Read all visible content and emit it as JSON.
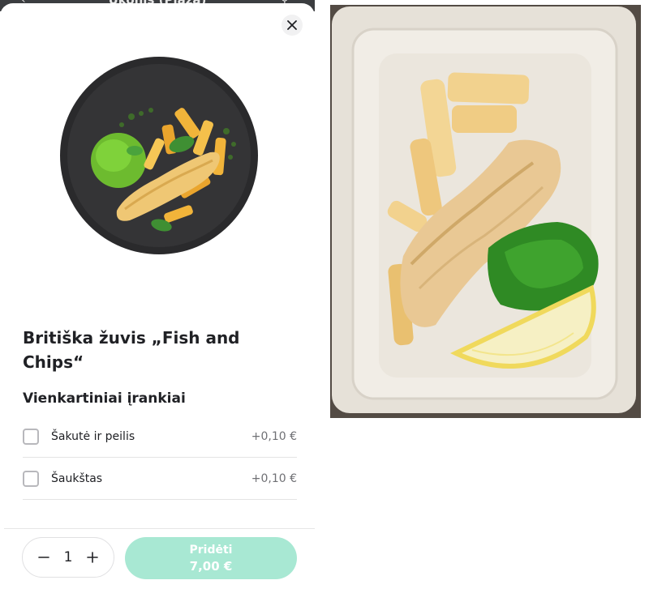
{
  "background_app": {
    "title": "Ukonis (Plaza)",
    "back_icon": "back-arrow-icon",
    "search_icon": "search-icon"
  },
  "sheet": {
    "close_icon": "close-icon",
    "product": {
      "title": "Britiška žuvis „Fish and Chips“"
    },
    "options_section": {
      "title": "Vienkartiniai įrankiai",
      "items": [
        {
          "label": "Šakutė ir peilis",
          "price": "+0,10 €",
          "checked": false
        },
        {
          "label": "Šaukštas",
          "price": "+0,10 €",
          "checked": false
        }
      ]
    },
    "footer": {
      "quantity": "1",
      "add_button": {
        "label": "Pridėti",
        "price": "7,00 €"
      }
    }
  },
  "colors": {
    "accent": "#a8e8d3",
    "text_primary": "#202125",
    "text_secondary": "#6f7074"
  }
}
